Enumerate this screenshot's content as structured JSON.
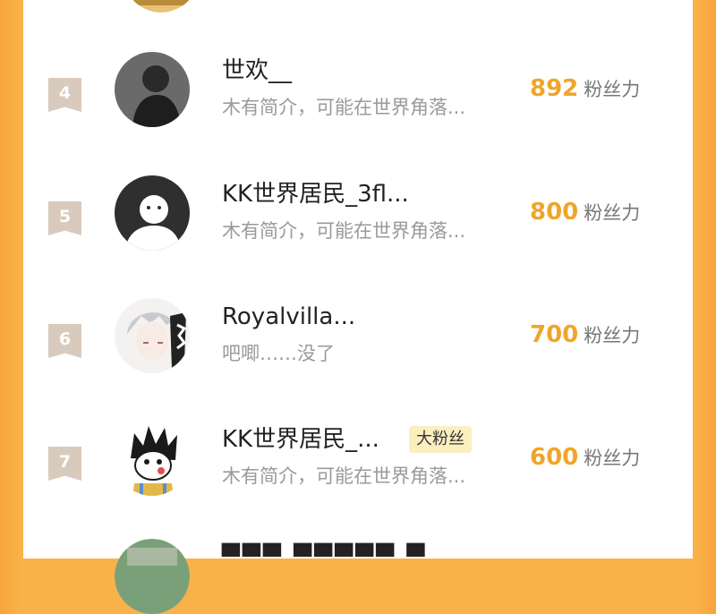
{
  "colors": {
    "accent": "#f0a52a",
    "rank_badge": "#d8cbbd",
    "background": "#f9b24a",
    "fan_badge": "#fbefc0"
  },
  "rows": [
    {
      "rank": "4",
      "name": "世欢__",
      "bio": "木有简介，可能在世界角落...",
      "score": "892",
      "unit": "粉丝力",
      "badge": ""
    },
    {
      "rank": "5",
      "name": "KK世界居民_3fl...",
      "bio": "木有简介，可能在世界角落...",
      "score": "800",
      "unit": "粉丝力",
      "badge": ""
    },
    {
      "rank": "6",
      "name": "Royalvilla...",
      "bio": "吧唧……没了",
      "score": "700",
      "unit": "粉丝力",
      "badge": ""
    },
    {
      "rank": "7",
      "name": "KK世界居民_...",
      "bio": "木有简介，可能在世界角落...",
      "score": "600",
      "unit": "粉丝力",
      "badge": "大粉丝"
    }
  ]
}
